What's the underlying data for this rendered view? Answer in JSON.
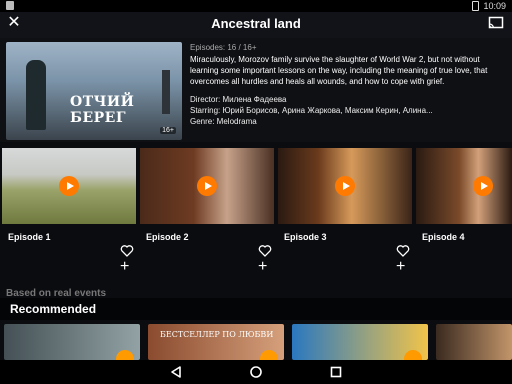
{
  "status": {
    "time": "10:09"
  },
  "header": {
    "title": "Ancestral land"
  },
  "details": {
    "episodes": "Episodes: 16 / 16+",
    "description": "Miraculously, Morozov family survive the slaughter of World War 2, but not without learning some important lessons on the way, including the meaning of true love, that overcomes all hurdles and heals all wounds, and how to cope with grief.",
    "director": "Director: Милена Фадеева",
    "starring": "Starring: Юрий Борисов, Арина Жаркова, Максим Керин, Алина...",
    "genre": "Genre: Melodrama",
    "poster_title": "ОТЧИЙ БЕРЕГ",
    "poster_badge": "16+"
  },
  "episodes": [
    {
      "label": "Episode 1"
    },
    {
      "label": "Episode 2"
    },
    {
      "label": "Episode 3"
    },
    {
      "label": "Episode 4"
    }
  ],
  "sections": {
    "based": "Based on real events",
    "recommended": "Recommended"
  },
  "recommended": [
    {
      "text": ""
    },
    {
      "text": "БЕСТСЕЛЛЕР ПО ЛЮБВИ"
    },
    {
      "text": ""
    },
    {
      "text": ""
    }
  ],
  "colors": {
    "accent": "#ff7a00",
    "background": "#0b0c10"
  },
  "icons": {
    "close": "close-icon",
    "cast": "cast-icon",
    "play": "play-icon",
    "heart": "heart-icon",
    "plus": "plus-icon",
    "back": "back-triangle-icon",
    "home": "home-circle-icon",
    "recents": "recents-square-icon"
  }
}
